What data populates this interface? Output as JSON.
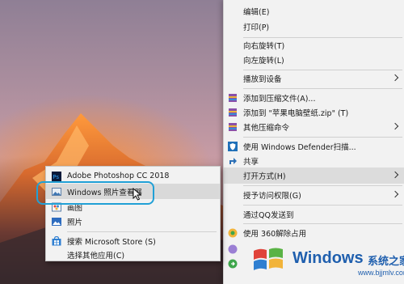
{
  "context_menu": {
    "items": [
      {
        "label": "编辑(E)",
        "icon": "none"
      },
      {
        "label": "打印(P)",
        "icon": "none"
      },
      {
        "label": "向右旋转(T)",
        "icon": "none"
      },
      {
        "label": "向左旋转(L)",
        "icon": "none"
      },
      {
        "label": "播放到设备",
        "icon": "none",
        "submenu": true
      },
      {
        "label": "添加到压缩文件(A)...",
        "icon": "archive-icon"
      },
      {
        "label": "添加到 \"苹果电脑壁纸.zip\" (T)",
        "icon": "archive-icon"
      },
      {
        "label": "其他压缩命令",
        "icon": "archive-icon",
        "submenu": true
      },
      {
        "label": "使用 Windows Defender扫描...",
        "icon": "defender-shield-icon"
      },
      {
        "label": "共享",
        "icon": "share-icon"
      },
      {
        "label": "打开方式(H)",
        "icon": "none",
        "submenu": true,
        "hover": true
      },
      {
        "label": "授予访问权限(G)",
        "icon": "none",
        "submenu": true
      },
      {
        "label": "通过QQ发送到",
        "icon": "none"
      },
      {
        "label": "使用 360解除占用",
        "icon": "360-icon"
      }
    ]
  },
  "open_with_submenu": {
    "items": [
      {
        "label": "Adobe Photoshop CC 2018",
        "icon": "photoshop-icon"
      },
      {
        "label": "Windows 照片查看器",
        "icon": "photo-viewer-icon",
        "hover": true
      },
      {
        "label": "画图",
        "icon": "paint-icon"
      },
      {
        "label": "照片",
        "icon": "photos-icon"
      },
      {
        "label": "搜索 Microsoft Store (S)",
        "icon": "store-icon"
      },
      {
        "label": "选择其他应用(C)",
        "icon": "none"
      }
    ]
  },
  "watermark": {
    "brand": "Windows",
    "cn_text": "系统之家",
    "site": "www.bjjmlv.com"
  },
  "colors": {
    "menu_bg": "#f2f2f2",
    "hover_bg": "#dcdcdc",
    "highlight_ring": "#21a0d6",
    "watermark_blue": "#1f5fae"
  }
}
